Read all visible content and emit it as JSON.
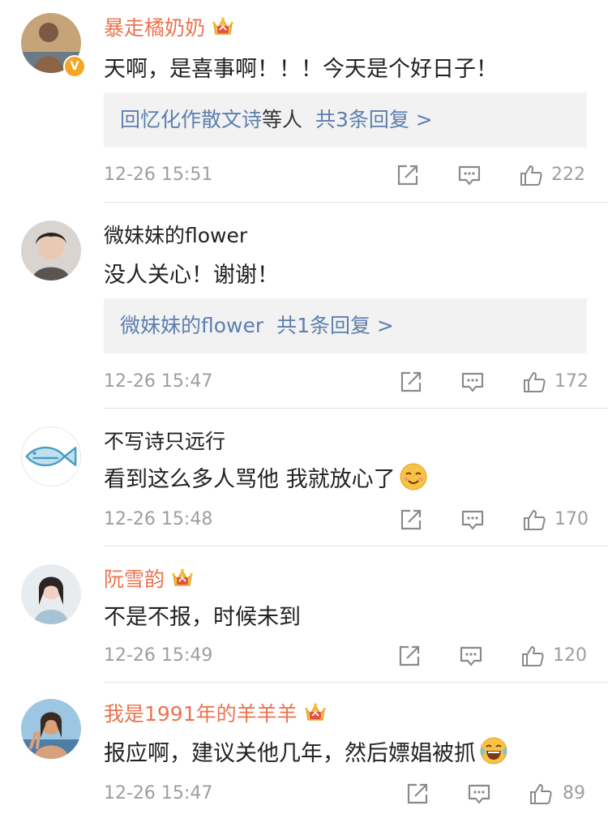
{
  "comments": [
    {
      "username": "暴走橘奶奶",
      "vip": true,
      "verified": true,
      "content": "天啊，是喜事啊！！！今天是个好日子！",
      "reply": {
        "names": "回忆化作散文诗",
        "middle": "等人",
        "link": "共3条回复 >"
      },
      "time": "12-26 15:51",
      "likes": "222",
      "avatar_icon": "man-portrait"
    },
    {
      "username": "微妹妹的flower",
      "vip": false,
      "content": "没人关心！谢谢！",
      "reply": {
        "names": "微妹妹的flower",
        "link": "共1条回复 >"
      },
      "time": "12-26 15:47",
      "likes": "172",
      "avatar_icon": "girl-portrait"
    },
    {
      "username": "不写诗只远行",
      "vip": false,
      "content": "看到这么多人骂他 我就放心了",
      "emoji": "smile-emoji",
      "time": "12-26 15:48",
      "likes": "170",
      "avatar_icon": "fish-avatar"
    },
    {
      "username": "阮雪韵",
      "vip": true,
      "content": "不是不报，时候未到",
      "time": "12-26 15:49",
      "likes": "120",
      "avatar_icon": "woman-portrait"
    },
    {
      "username": "我是1991年的羊羊羊",
      "vip": true,
      "content": "报应啊，建议关他几年，然后嫖娼被抓",
      "emoji": "laugh-tears-emoji",
      "time": "12-26 15:47",
      "likes": "89",
      "avatar_icon": "woman-peace-sign"
    }
  ],
  "colors": {
    "vip_name": "#eb7350",
    "link": "#5d7fae",
    "meta": "#9e9e9e",
    "reply_bg": "#f2f2f2"
  }
}
